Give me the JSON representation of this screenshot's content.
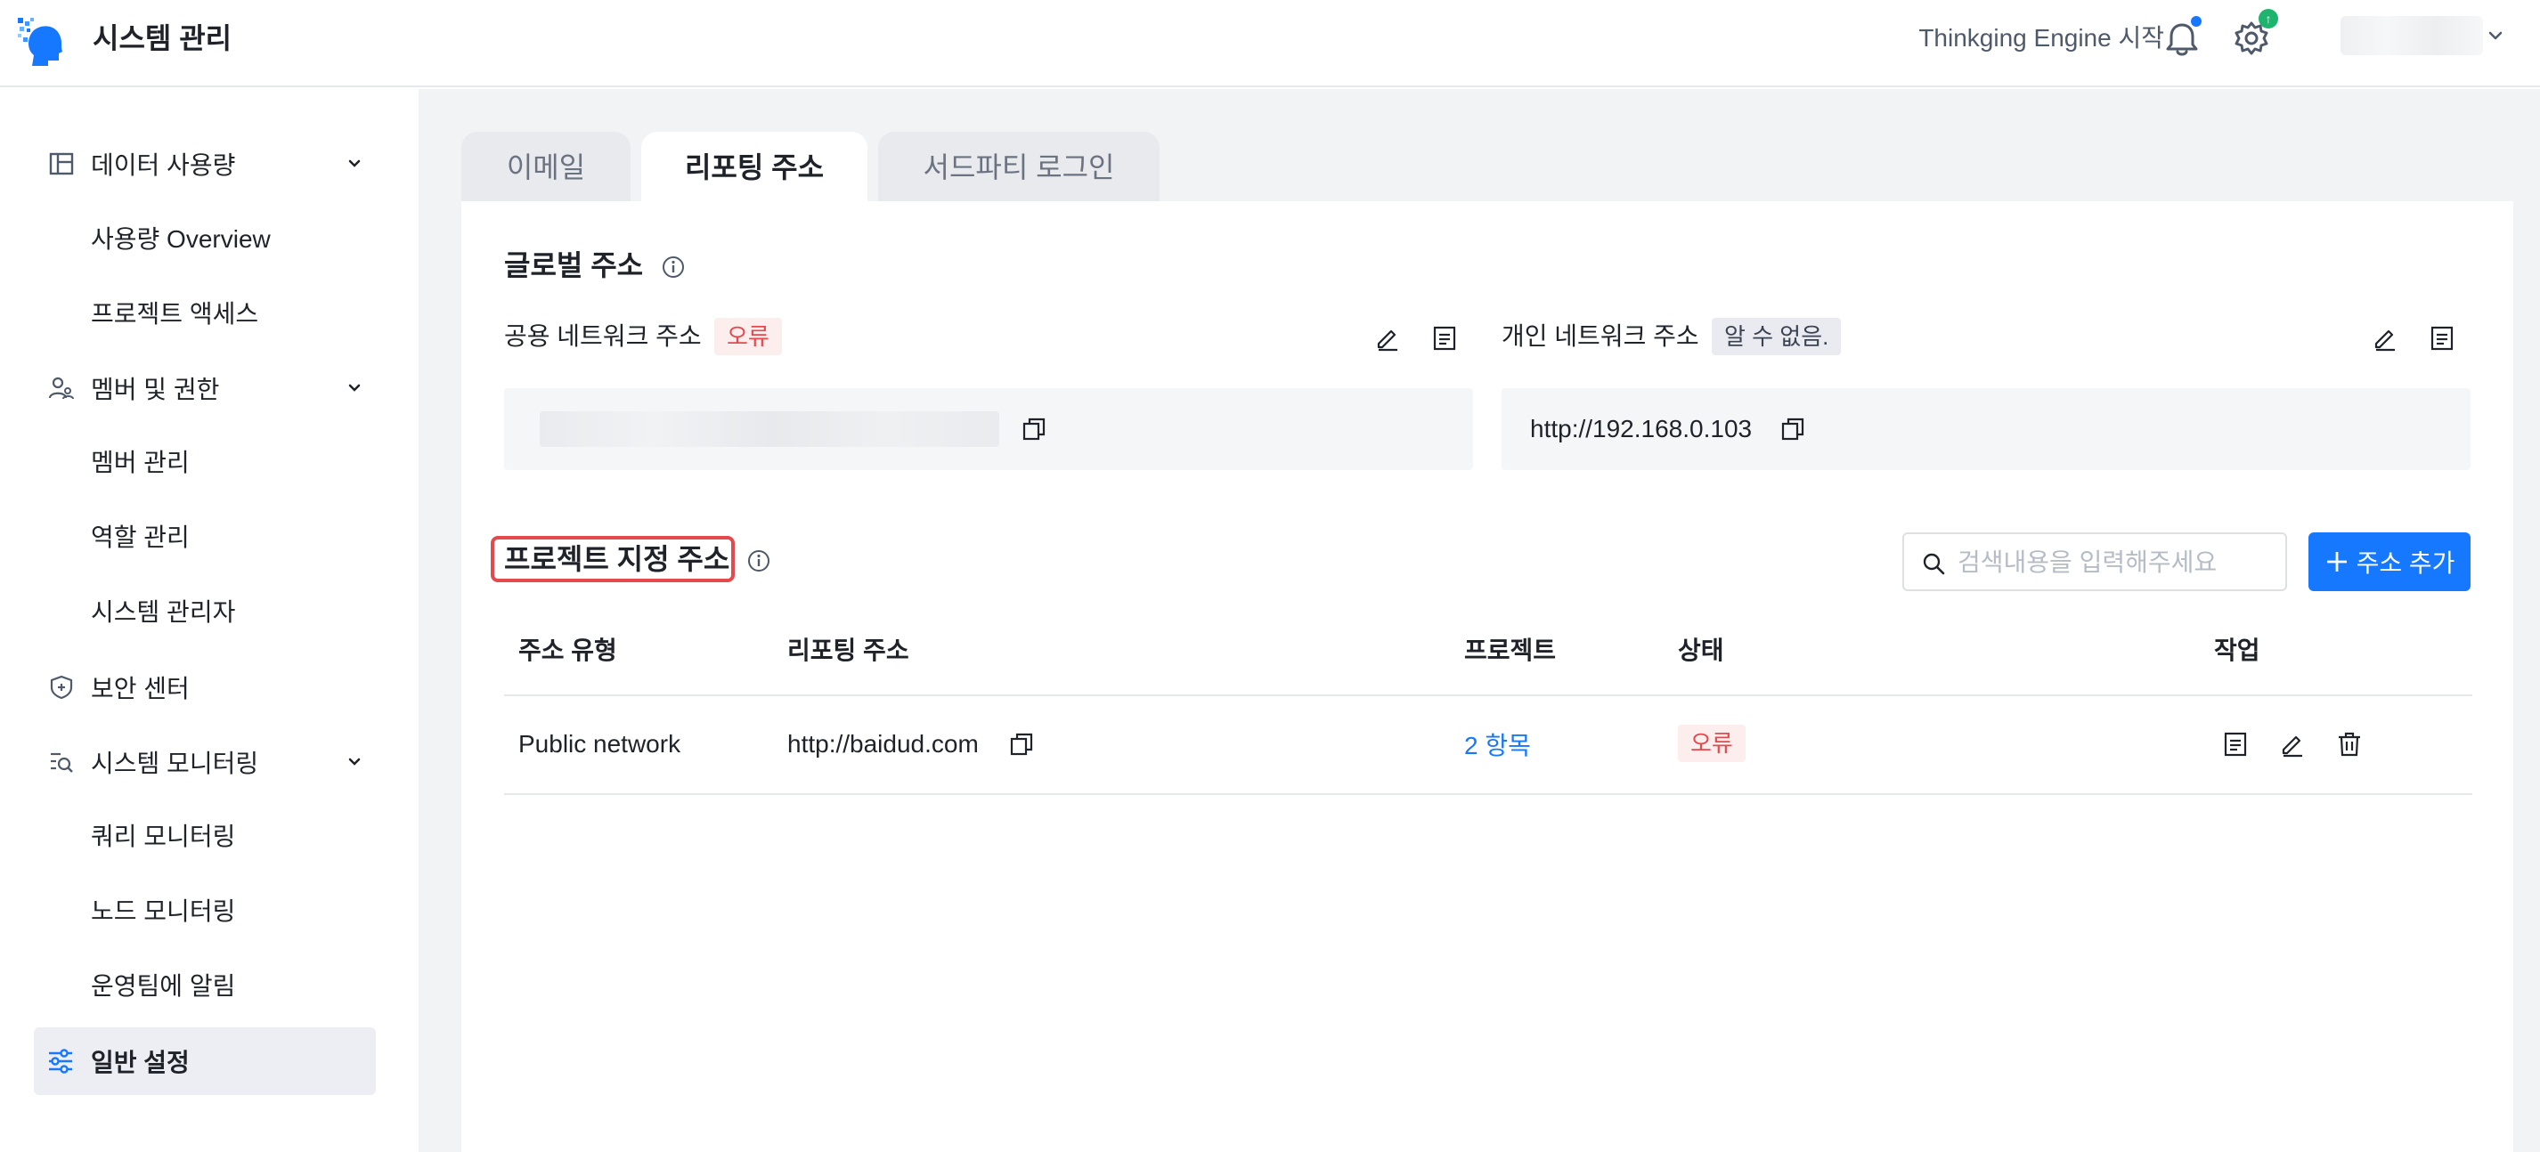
{
  "header": {
    "title": "시스템 관리",
    "engine_link": "Thinkging Engine 시작",
    "gear_badge": "↑",
    "icons": [
      "brain-head-logo",
      "bell-icon",
      "gear-icon",
      "chevron-down-icon"
    ]
  },
  "sidebar": {
    "groups": [
      {
        "label": "데이터 사용량",
        "icon": "layout-icon",
        "children": [
          "사용량 Overview",
          "프로젝트 액세스"
        ]
      },
      {
        "label": "멤버 및 권한",
        "icon": "users-icon",
        "children": [
          "멤버 관리",
          "역할 관리",
          "시스템 관리자"
        ]
      },
      {
        "label": "보안 센터",
        "icon": "shield-icon",
        "children": []
      },
      {
        "label": "시스템 모니터링",
        "icon": "monitor-search-icon",
        "children": [
          "쿼리 모니터링",
          "노드 모니터링",
          "운영팀에 알림"
        ]
      }
    ],
    "active": {
      "label": "일반 설정",
      "icon": "sliders-icon"
    }
  },
  "tabs": [
    {
      "label": "이메일",
      "active": false
    },
    {
      "label": "리포팅 주소",
      "active": true
    },
    {
      "label": "서드파티 로그인",
      "active": false
    }
  ],
  "global": {
    "title": "글로벌 주소",
    "public": {
      "label": "공용 네트워크 주소",
      "status": "오류",
      "value": ""
    },
    "private": {
      "label": "개인 네트워크 주소",
      "status": "알 수 없음.",
      "value": "http://192.168.0.103"
    }
  },
  "project": {
    "title": "프로젝트 지정 주소",
    "search_placeholder": "검색내용을 입력해주세요",
    "add_label": "주소 추가",
    "columns": [
      "주소 유형",
      "리포팅 주소",
      "프로젝트",
      "상태",
      "작업"
    ],
    "rows": [
      {
        "type": "Public network",
        "address": "http://baidud.com",
        "project": "2 항목",
        "status": "오류"
      }
    ]
  },
  "colors": {
    "accent": "#1677ff",
    "error": "#e5484d",
    "error_bg": "#fdeeee",
    "badge_green": "#1fb46e"
  }
}
